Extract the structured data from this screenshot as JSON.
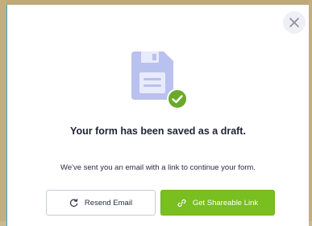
{
  "modal": {
    "title": "Your form has been saved as a draft.",
    "message": "We've sent you an email with a link to continue your form.",
    "close_icon": "close-icon",
    "save_icon": "floppy-disk-icon",
    "check_icon": "check-circle-icon"
  },
  "buttons": {
    "resend_label": "Resend Email",
    "resend_icon": "refresh-icon",
    "share_label": "Get Shareable Link",
    "share_icon": "link-icon"
  },
  "colors": {
    "accent_green": "#78bf1f",
    "icon_blue": "#b9c1ee",
    "check_green": "#6aa92a"
  }
}
